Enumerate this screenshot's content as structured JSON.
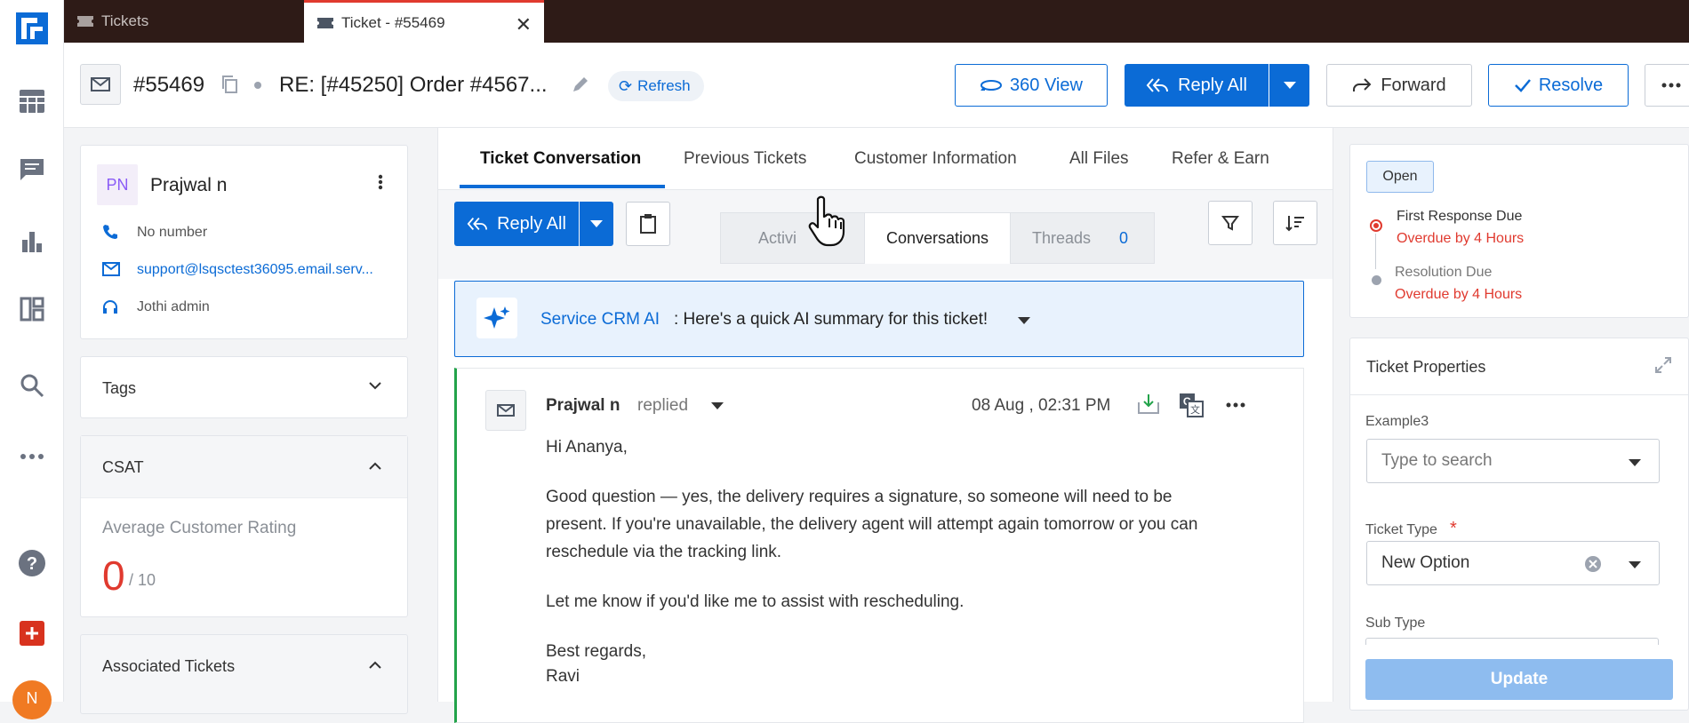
{
  "tabs": [
    {
      "label": "Tickets"
    },
    {
      "label": "Ticket - #55469"
    }
  ],
  "header": {
    "ticket_id": "#55469",
    "subject": "RE: [#45250] Order #4567...",
    "refresh_label": "Refresh",
    "view360_label": "360 View",
    "reply_all_label": "Reply All",
    "forward_label": "Forward",
    "resolve_label": "Resolve"
  },
  "contact": {
    "initials": "PN",
    "name": "Prajwal n",
    "phone": "No number",
    "email": "support@lsqsctest36095.email.serv...",
    "agent": "Jothi admin"
  },
  "panels": {
    "tags": "Tags",
    "csat": "CSAT",
    "avg_rating_label": "Average Customer Rating",
    "rating_value": "0",
    "rating_total": "/ 10",
    "associated": "Associated Tickets"
  },
  "main_tabs": [
    {
      "label": "Ticket Conversation"
    },
    {
      "label": "Previous Tickets"
    },
    {
      "label": "Customer Information"
    },
    {
      "label": "All Files"
    },
    {
      "label": "Refer & Earn"
    }
  ],
  "toolbar": {
    "reply_all_label": "Reply All"
  },
  "subtabs": {
    "activity": "Activi",
    "conversations": "Conversations",
    "threads": "Threads",
    "threads_count": "0"
  },
  "ai": {
    "brand": "Service CRM AI",
    "text": " : Here's a quick AI summary for this ticket!"
  },
  "message": {
    "author": "Prajwal n",
    "action": "replied",
    "timestamp": "08 Aug , 02:31 PM",
    "greeting": "Hi Ananya,",
    "para1_line1": "Good question — yes, the delivery requires a signature, so someone will need to be",
    "para1_line2": "present. If you're unavailable, the delivery agent will attempt again tomorrow or you can",
    "para1_line3": "reschedule via the tracking link.",
    "para2": "Let me know if you'd like me to assist with rescheduling.",
    "signoff": "Best regards,",
    "signature": "Ravi"
  },
  "sla": {
    "status": "Open",
    "first_response_label": "First Response Due",
    "first_response_value": "Overdue by 4 Hours",
    "resolution_label": "Resolution Due",
    "resolution_value": "Overdue by 4 Hours"
  },
  "properties": {
    "title": "Ticket Properties",
    "example3_label": "Example3",
    "example3_placeholder": "Type to search",
    "ticket_type_label": "Ticket Type",
    "required_mark": "*",
    "ticket_type_value": "New Option",
    "sub_type_label": "Sub Type",
    "update_label": "Update"
  },
  "avatar_initial": "N",
  "colors": {
    "primary": "#0b6bd6",
    "danger": "#e03a2f",
    "tabbar": "#2e1b17"
  }
}
